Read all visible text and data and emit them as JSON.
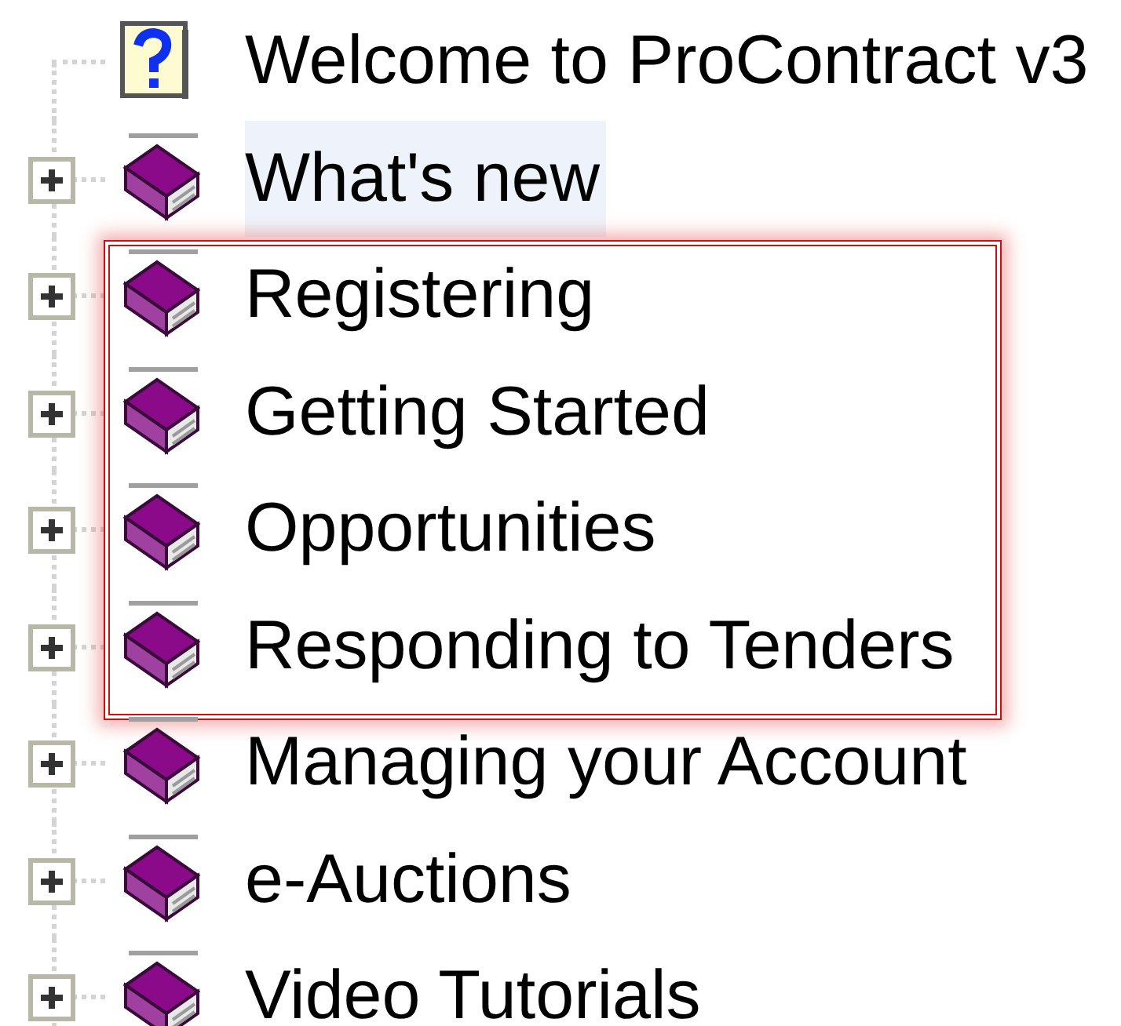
{
  "tree": {
    "items": [
      {
        "kind": "page",
        "label": "Welcome to ProContract v3",
        "selected": false,
        "highlighted": false
      },
      {
        "kind": "book",
        "label": "What's new",
        "selected": true,
        "expanded": false,
        "highlighted": false
      },
      {
        "kind": "book",
        "label": "Registering",
        "selected": false,
        "expanded": false,
        "highlighted": true
      },
      {
        "kind": "book",
        "label": "Getting Started",
        "selected": false,
        "expanded": false,
        "highlighted": true
      },
      {
        "kind": "book",
        "label": "Opportunities",
        "selected": false,
        "expanded": false,
        "highlighted": true
      },
      {
        "kind": "book",
        "label": "Responding to Tenders",
        "selected": false,
        "expanded": false,
        "highlighted": true
      },
      {
        "kind": "book",
        "label": "Managing your Account",
        "selected": false,
        "expanded": false,
        "highlighted": false
      },
      {
        "kind": "book",
        "label": "e-Auctions",
        "selected": false,
        "expanded": false,
        "highlighted": false
      },
      {
        "kind": "book",
        "label": "Video Tutorials",
        "selected": false,
        "expanded": false,
        "highlighted": false
      }
    ]
  }
}
